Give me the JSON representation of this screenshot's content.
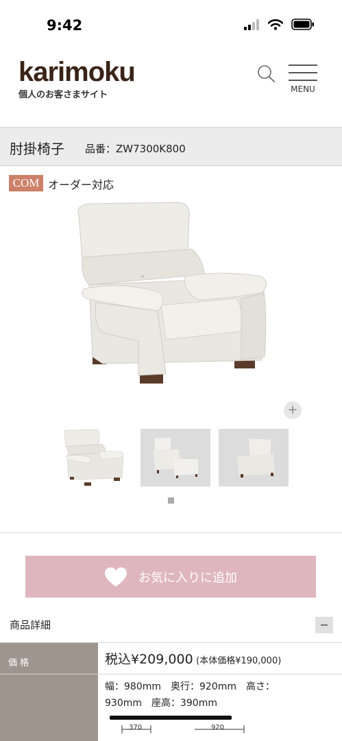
{
  "status": {
    "time": "9:42"
  },
  "header": {
    "logo": "karimoku",
    "logo_sub": "個人のお客さまサイト",
    "menu_label": "MENU"
  },
  "product": {
    "name": "肘掛椅子",
    "code": "品番：ZW7300K800"
  },
  "badge": {
    "label": "COM",
    "text": "オーダー対応"
  },
  "gallery": {
    "zoom_icon": "+"
  },
  "favorite": {
    "label": "お気に入りに追加"
  },
  "details": {
    "title": "商品詳細",
    "price_label": "価 格",
    "price_main": "税込¥209,000",
    "price_sub": "(本体価格¥190,000)",
    "size_line1": "幅：980mm　奥行：920mm　高さ：",
    "size_line2": "930mm　座高：390mm",
    "diagram_values": [
      "370",
      "920"
    ]
  },
  "colors": {
    "badge": "#cc8068",
    "favorite": "#dfb6bd",
    "table_head": "#9e958e",
    "logo": "#3a2418"
  }
}
